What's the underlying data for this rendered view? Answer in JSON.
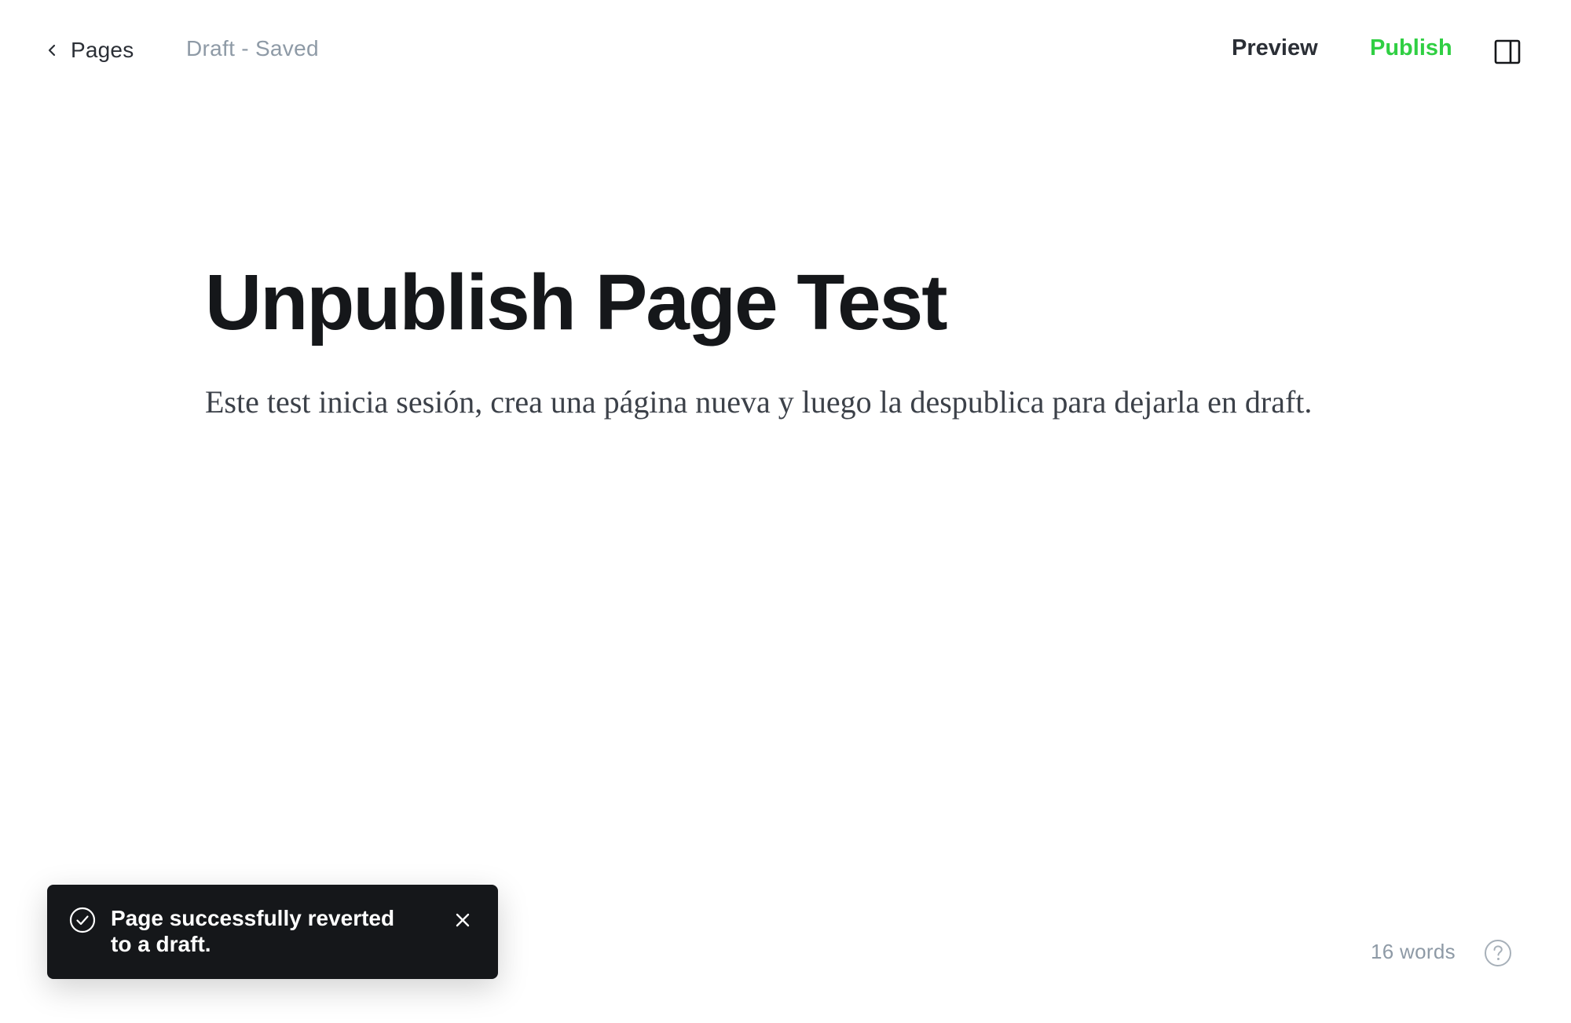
{
  "header": {
    "back_label": "Pages",
    "status": "Draft - Saved",
    "preview_label": "Preview",
    "publish_label": "Publish",
    "icons": {
      "back": "chevron-left-icon",
      "sidebar": "sidebar-panel-icon"
    }
  },
  "editor": {
    "title": "Unpublish Page Test",
    "body": "Este test inicia sesión, crea una página nueva y luego la despublica para dejarla en draft."
  },
  "toast": {
    "message": "Page successfully reverted to a draft.",
    "icons": {
      "status": "check-circle-icon",
      "close": "close-icon"
    }
  },
  "footer": {
    "word_count": "16 words",
    "help_icon": "question-circle-icon"
  },
  "colors": {
    "accent_publish": "#30cf43",
    "text_primary": "#15171a",
    "text_muted": "#8e9aa6",
    "toast_bg": "#15171a"
  }
}
